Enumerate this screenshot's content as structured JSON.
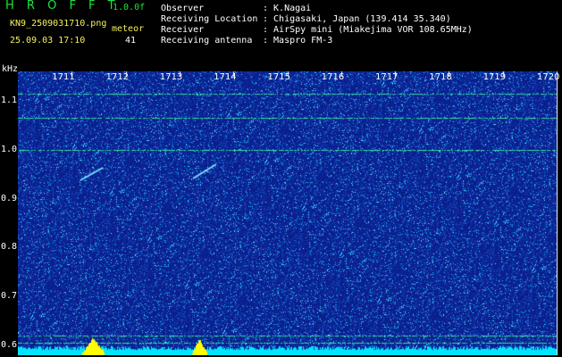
{
  "header": {
    "app_name": "H R O F F T",
    "version": "1.0.0f",
    "filename": "KN9_2509031710.png",
    "meteor_label": "meteor",
    "timestamp": "25.09.03 17:10",
    "meteor_count": "41"
  },
  "meta": [
    {
      "key": "Observer",
      "value": ": K.Nagai"
    },
    {
      "key": "Receiving Location",
      "value": ": Chigasaki, Japan (139.414 35.340)"
    },
    {
      "key": "Receiver",
      "value": ": AirSpy mini (Miakejima VOR 108.65MHz)"
    },
    {
      "key": "Receiving antenna",
      "value": ": Maspro FM-3"
    }
  ],
  "spectrogram": {
    "freq_unit": "kHz",
    "y_ticks": [
      "1.1",
      "1.0",
      "0.9",
      "0.8",
      "0.7",
      "0.6"
    ],
    "y_range": [
      0.58,
      1.16
    ],
    "time_ticks": [
      "1711",
      "1712",
      "1713",
      "1714",
      "1715",
      "1716",
      "1717",
      "1718",
      "1719",
      "1720"
    ],
    "time_range": [
      1710,
      1720
    ],
    "carrier_lines_khz": [
      1.115,
      1.065,
      1.0,
      0.62,
      0.605
    ],
    "colors": {
      "background": "#0a1f8c",
      "noise": "#1ec8ff",
      "carrier": "#34e3a0",
      "power_fill": "#00e5ff",
      "power_peak": "#ffff00"
    }
  }
}
